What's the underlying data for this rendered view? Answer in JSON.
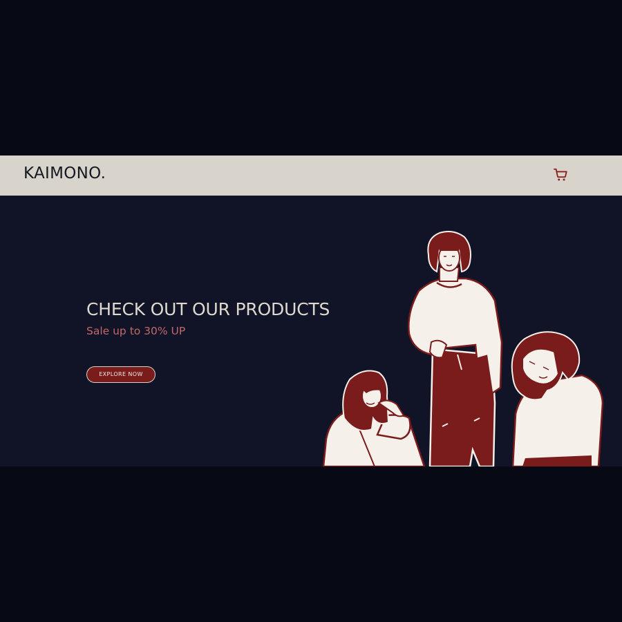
{
  "navbar": {
    "brand": "KAIMONO.",
    "cart_icon": "shopping-cart-icon"
  },
  "hero": {
    "headline": "CHECK OUT OUR PRODUCTS",
    "subheadline": "Sale up to 30% UP",
    "cta_label": "EXPLORE NOW",
    "illustration": "three-women-fashion-illustration"
  },
  "colors": {
    "page_background": "#070a14",
    "navbar_background": "#d8d4cb",
    "hero_background": "#111427",
    "accent": "#7a1c1c",
    "subheadline": "#c3686a",
    "headline": "#ded9cf"
  }
}
